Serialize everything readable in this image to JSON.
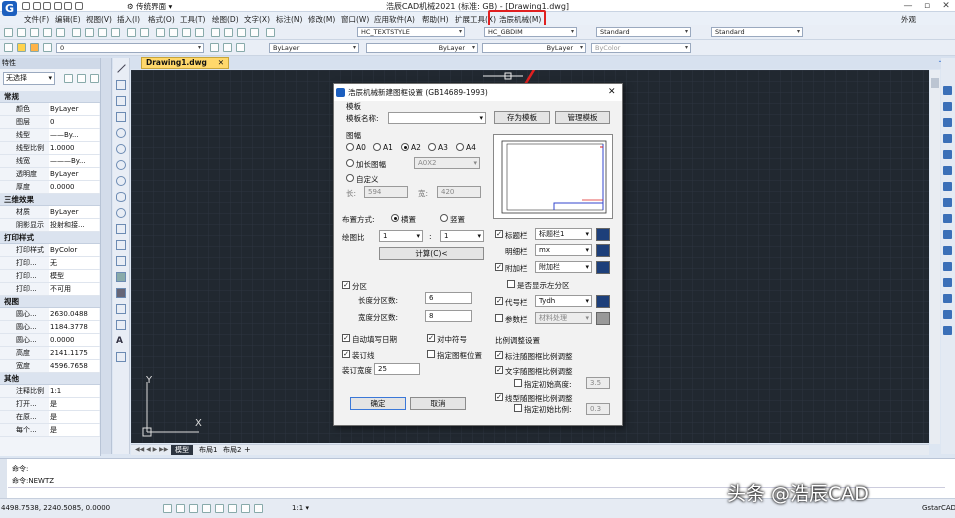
{
  "app": {
    "title": "浩辰CAD机械2021  (标准: GB)  - [Drawing1.dwg]",
    "quick_label": "传统界面",
    "workspace_label": "外观"
  },
  "menu": [
    "文件(F)",
    "编辑(E)",
    "视图(V)",
    "插入(I)",
    "格式(O)",
    "工具(T)",
    "绘图(D)",
    "文字(X)",
    "标注(N)",
    "修改(M)",
    "窗口(W)",
    "应用软件(A)",
    "帮助(H)",
    "扩展工具(X)",
    "浩辰机械(M)"
  ],
  "toolbar": {
    "text_style": "HC_TEXTSTYLE",
    "dim_style": "HC_GBDIM",
    "table_style": "Standard",
    "mleader_style": "Standard",
    "layer": "0",
    "color": "ByLayer",
    "linetype": "ByLayer",
    "lineweight": "ByLayer",
    "plotstyle": "ByColor"
  },
  "document_tab": "Drawing1.dwg",
  "properties": {
    "title": "特性",
    "selection": "无选择",
    "sections": [
      {
        "name": "常规",
        "rows": [
          [
            "颜色",
            "ByLayer"
          ],
          [
            "图层",
            "0"
          ],
          [
            "线型",
            "——By..."
          ],
          [
            "线型比例",
            "1.0000"
          ],
          [
            "线宽",
            "———By..."
          ],
          [
            "透明度",
            "ByLayer"
          ],
          [
            "厚度",
            "0.0000"
          ]
        ]
      },
      {
        "name": "三维效果",
        "rows": [
          [
            "材质",
            "ByLayer"
          ],
          [
            "阴影显示",
            "投射和接..."
          ]
        ]
      },
      {
        "name": "打印样式",
        "rows": [
          [
            "打印样式",
            "ByColor"
          ],
          [
            "打印...",
            "无"
          ],
          [
            "打印...",
            "模型"
          ],
          [
            "打印...",
            "不可用"
          ]
        ]
      },
      {
        "name": "视图",
        "rows": [
          [
            "圆心...",
            "2630.0488"
          ],
          [
            "圆心...",
            "1184.3778"
          ],
          [
            "圆心...",
            "0.0000"
          ],
          [
            "高度",
            "2141.1175"
          ],
          [
            "宽度",
            "4596.7658"
          ]
        ]
      },
      {
        "name": "其他",
        "rows": [
          [
            "注释比例",
            "1:1"
          ],
          [
            "打开...",
            "是"
          ],
          [
            "在原...",
            "是"
          ],
          [
            "每个...",
            "是"
          ]
        ]
      }
    ]
  },
  "layout_tabs": [
    "模型",
    "布局1",
    "布局2"
  ],
  "command": {
    "lines": [
      "命令:",
      "命令:NEWTZ"
    ]
  },
  "status": {
    "coords": "4498.7538, 2240.5085, 0.0000",
    "scale": "1:1",
    "app_label": "GstarCAD"
  },
  "ucs": {
    "x": "X",
    "y": "Y"
  },
  "watermark": "头条 @浩辰CAD",
  "dialog": {
    "title": "浩辰机械新建图框设置 (GB14689-1993)",
    "template_group": "模板",
    "template_name_label": "模板名称:",
    "save_template": "存为模板",
    "manage_template": "管理模板",
    "size_group": "图幅",
    "sizes": [
      "A0",
      "A1",
      "A2",
      "A3",
      "A4"
    ],
    "size_selected": "A2",
    "extended_label": "加长图幅",
    "extended_value": "A0X2",
    "custom_label": "自定义",
    "length_label": "长:",
    "length_value": "594",
    "width_label": "宽:",
    "width_value": "420",
    "layout_label": "布置方式:",
    "layout_options": [
      "横置",
      "竖置"
    ],
    "layout_selected": "横置",
    "scale_label": "绘图比",
    "scale_left": "1",
    "scale_colon": ":",
    "scale_right": "1",
    "calc_button": "计算(C)<",
    "zone_label": "分区",
    "zone_length_label": "长度分区数:",
    "zone_length_value": "6",
    "zone_width_label": "宽度分区数:",
    "zone_width_value": "8",
    "auto_date": "自动填写日期",
    "center_mark": "对中符号",
    "binding_line": "装订线",
    "specify_pos": "指定图框位置",
    "binding_width_label": "装订宽度",
    "binding_width_value": "25",
    "ok": "确定",
    "cancel": "取消",
    "blocks": [
      {
        "label": "标题栏",
        "checked": true,
        "value": "标题栏1",
        "disabled": false
      },
      {
        "label": "明细栏",
        "checked": false,
        "value": "mx",
        "disabled": false
      },
      {
        "label": "附加栏",
        "checked": true,
        "value": "附加栏",
        "disabled": false
      },
      {
        "label": "代号栏",
        "checked": true,
        "value": "Tydh",
        "disabled": false
      },
      {
        "label": "参数栏",
        "checked": false,
        "value": "材料处理",
        "disabled": true
      }
    ],
    "show_left": "是否显示左分区",
    "ratio_group": "比例调整设置",
    "annot_follow": "标注随图框比例调整",
    "text_follow": "文字随图框比例调整",
    "init_height_label": "指定初始高度:",
    "init_height_value": "3.5",
    "linetype_follow": "线型随图框比例调整",
    "init_scale_label": "指定初始比例:",
    "init_scale_value": "0.3"
  }
}
